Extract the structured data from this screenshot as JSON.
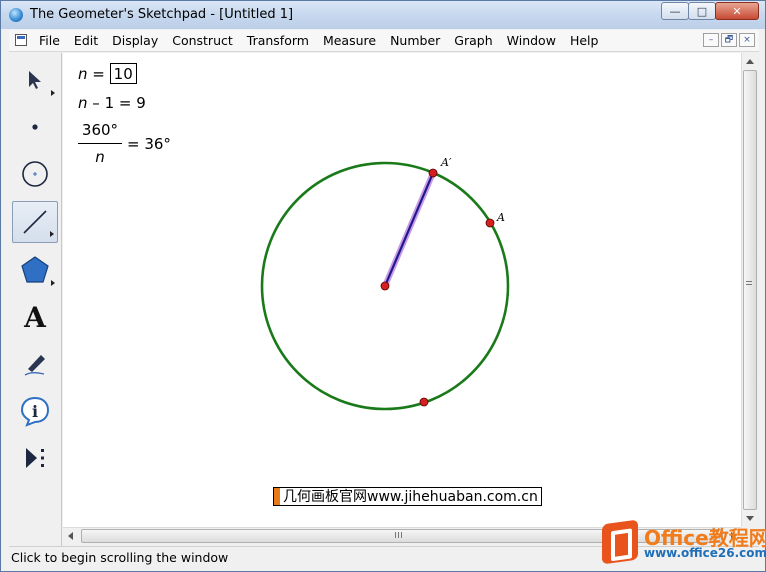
{
  "window": {
    "title": "The Geometer's Sketchpad - [Untitled 1]",
    "caption_buttons": [
      "—",
      "□",
      "✕"
    ]
  },
  "menubar": {
    "items": [
      "File",
      "Edit",
      "Display",
      "Construct",
      "Transform",
      "Measure",
      "Number",
      "Graph",
      "Window",
      "Help"
    ],
    "mdi_buttons": [
      "–",
      "🗗",
      "×"
    ]
  },
  "toolbox": {
    "tools": [
      {
        "name": "Arrow Tool",
        "icon": "arrow-pointer-icon"
      },
      {
        "name": "Point Tool",
        "icon": "point-icon"
      },
      {
        "name": "Compass Tool",
        "icon": "compass-circle-icon"
      },
      {
        "name": "Straightedge Tool",
        "icon": "segment-icon",
        "active": true
      },
      {
        "name": "Polygon Tool",
        "icon": "pentagon-icon"
      },
      {
        "name": "Text Tool",
        "icon": "text-A-icon"
      },
      {
        "name": "Marker Tool",
        "icon": "marker-pen-icon"
      },
      {
        "name": "Information Tool",
        "icon": "info-icon"
      },
      {
        "name": "Custom Tools",
        "icon": "custom-tools-icon"
      }
    ]
  },
  "sketch": {
    "param_var": "n",
    "param_eq": "=",
    "param_value": "10",
    "calc1_var": "n",
    "calc1_rest": "– 1 = 9",
    "calc2_numerator": "360°",
    "calc2_denominator": "n",
    "calc2_result": "= 36°",
    "label_A_prime": "A′",
    "label_A": "A",
    "circle_color": "#1a7a1a",
    "segment_color": "#1e1a8c",
    "point_color": "#d42020",
    "caption": "几何画板官网www.jihehuaban.com.cn"
  },
  "statusbar": {
    "text": "Click to begin scrolling the window"
  },
  "watermark": {
    "title": "Office教程网",
    "url": "www.office26.com"
  }
}
